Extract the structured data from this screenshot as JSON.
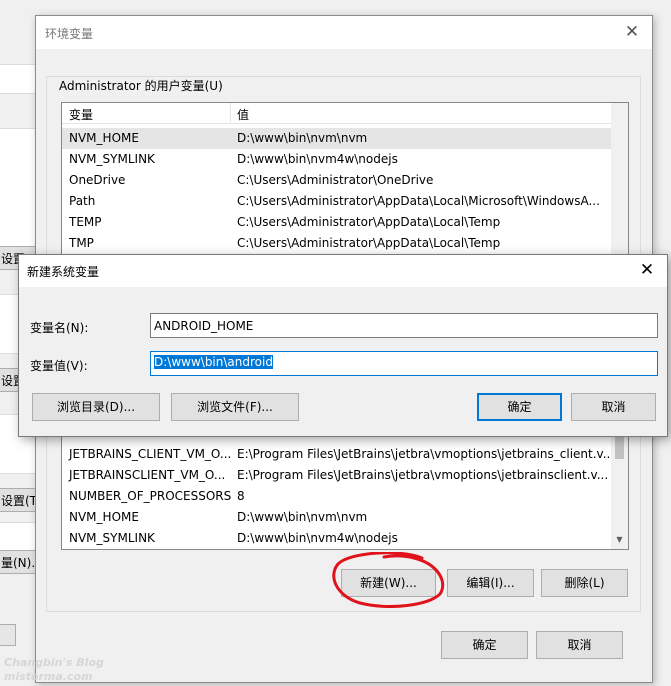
{
  "background_window": {
    "buttons": [
      "设置",
      "设置",
      "设置(T)...",
      "量(N)..."
    ]
  },
  "env_window": {
    "title": "环境变量",
    "close_glyph": "✕",
    "user_group_label": "Administrator 的用户变量(U)",
    "columns": [
      "变量",
      "值"
    ],
    "user_vars": [
      {
        "name": "NVM_HOME",
        "value": "D:\\www\\bin\\nvm\\nvm"
      },
      {
        "name": "NVM_SYMLINK",
        "value": "D:\\www\\bin\\nvm4w\\nodejs"
      },
      {
        "name": "OneDrive",
        "value": "C:\\Users\\Administrator\\OneDrive"
      },
      {
        "name": "Path",
        "value": "C:\\Users\\Administrator\\AppData\\Local\\Microsoft\\WindowsA..."
      },
      {
        "name": "TEMP",
        "value": "C:\\Users\\Administrator\\AppData\\Local\\Temp"
      },
      {
        "name": "TMP",
        "value": "C:\\Users\\Administrator\\AppData\\Local\\Temp"
      }
    ],
    "system_vars": [
      {
        "name": "JETBRAINS_CLIENT_VM_O...",
        "value": "E:\\Program Files\\JetBrains\\jetbra\\vmoptions\\jetbrains_client.v..."
      },
      {
        "name": "JETBRAINSCLIENT_VM_O...",
        "value": "E:\\Program Files\\JetBrains\\jetbra\\vmoptions\\jetbrainsclient.v..."
      },
      {
        "name": "NUMBER_OF_PROCESSORS",
        "value": "8"
      },
      {
        "name": "NVM_HOME",
        "value": "D:\\www\\bin\\nvm\\nvm"
      },
      {
        "name": "NVM_SYMLINK",
        "value": "D:\\www\\bin\\nvm4w\\nodejs"
      }
    ],
    "system_buttons": {
      "new": "新建(W)...",
      "edit": "编辑(I)...",
      "delete": "删除(L)"
    },
    "ok": "确定",
    "cancel": "取消"
  },
  "new_var_dialog": {
    "title": "新建系统变量",
    "close_glyph": "✕",
    "name_label": "变量名(N):",
    "name_value": "ANDROID_HOME",
    "value_label": "变量值(V):",
    "value_value": "D:\\www\\bin\\android",
    "browse_dir": "浏览目录(D)...",
    "browse_file": "浏览文件(F)...",
    "ok": "确定",
    "cancel": "取消"
  },
  "annotation_color": "#e0121b",
  "watermark": {
    "line1": "Changbin's Blog",
    "line2": "misterma.com"
  }
}
